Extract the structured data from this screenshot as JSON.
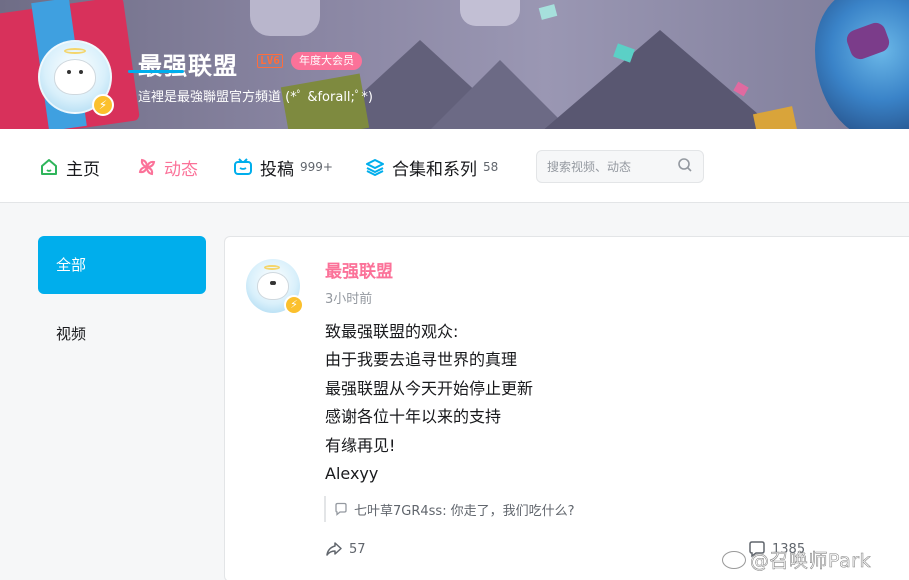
{
  "header": {
    "username": "最强联盟",
    "level_badge": "LV6",
    "vip_badge": "年度大会员",
    "signature": "這裡是最強聯盟官方頻道 (*ﾟ &forall;ﾟ*)"
  },
  "nav": {
    "tabs": [
      {
        "label": "主页",
        "icon": "home-icon"
      },
      {
        "label": "动态",
        "icon": "pinwheel-icon",
        "active": true
      },
      {
        "label": "投稿",
        "icon": "tv-icon",
        "count": "999+"
      },
      {
        "label": "合集和系列",
        "icon": "layers-icon",
        "count": "58"
      }
    ],
    "search_placeholder": "搜索视频、动态"
  },
  "sidebar": {
    "items": [
      {
        "label": "全部",
        "active": true
      },
      {
        "label": "视频"
      }
    ]
  },
  "post": {
    "author": "最强联盟",
    "time": "3小时前",
    "lines": [
      "致最强联盟的观众:",
      "由于我要去追寻世界的真理",
      "最强联盟从今天开始停止更新",
      "感谢各位十年以来的支持",
      "有缘再见!",
      "Alexyy"
    ],
    "comment_user": "七叶草7GR4ss:",
    "comment_text": "你走了，我们吃什么?",
    "share_count": "57",
    "reply_count": "1385"
  },
  "watermark": "@召唤师Park",
  "colors": {
    "accent_blue": "#00aeec",
    "accent_pink": "#fb7299",
    "level_orange": "#ff6d3a"
  }
}
